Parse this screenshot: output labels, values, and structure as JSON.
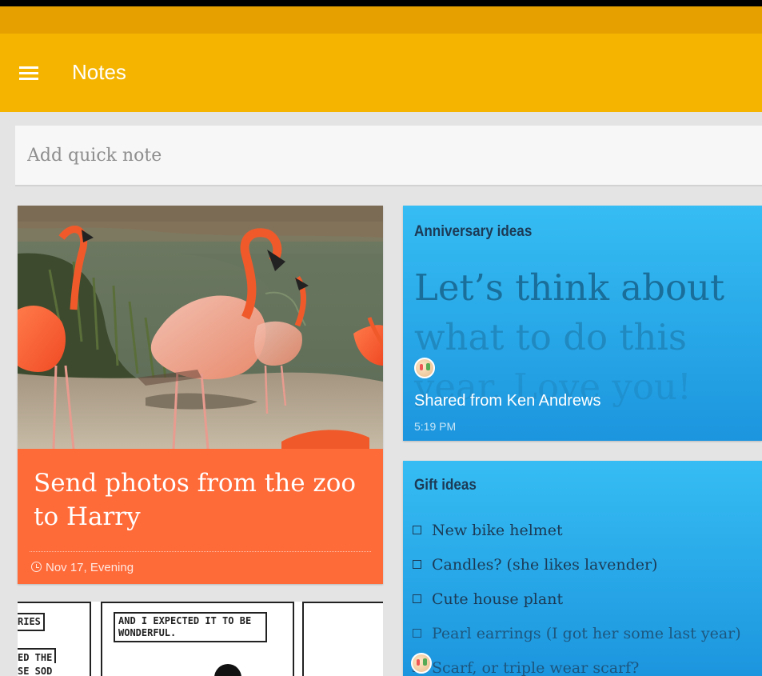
{
  "app": {
    "title": "Notes"
  },
  "quick_note": {
    "placeholder": "Add quick note"
  },
  "photo_note": {
    "title": "Send photos from the zoo to Harry",
    "reminder": "Nov 17, Evening"
  },
  "comic_note": {
    "panel_1_lines": [
      "RIES",
      "ED THE",
      "SE SOD"
    ],
    "panel_2_text": "AND I EXPECTED IT TO BE WONDERFUL."
  },
  "anniversary_note": {
    "title": "Anniversary ideas",
    "body_line_1": "Let’s think about",
    "body_line_2": "what to do this",
    "body_line_3": "year. Love you!",
    "shared_from": "Shared from Ken Andrews",
    "time": "5:19 PM"
  },
  "gift_note": {
    "title": "Gift ideas",
    "items": [
      "New bike helmet",
      "Candles? (she likes lavender)",
      "Cute house plant",
      "Pearl earrings (I got her some last year)",
      "Scarf, or triple wear scarf?"
    ]
  },
  "colors": {
    "app_bar": "#f4b400",
    "status_bar": "#e6a100",
    "photo_note": "#ff6a39",
    "blue_note": "#36bdf3"
  }
}
